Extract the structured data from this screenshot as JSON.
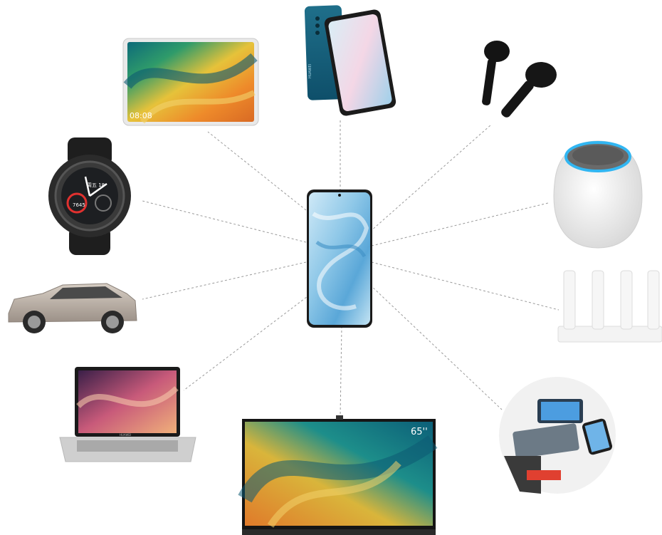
{
  "hub": {
    "icon": "smartphone-hub-icon"
  },
  "devices": [
    {
      "id": "tablet",
      "icon": "tablet-icon",
      "screen_time": "08:08"
    },
    {
      "id": "phone",
      "icon": "smartphone-icon",
      "brand": "HUAWEI"
    },
    {
      "id": "earbuds",
      "icon": "earbuds-icon"
    },
    {
      "id": "smartwatch",
      "icon": "smartwatch-icon",
      "dial_date": "周五 18",
      "dial_steps": "7645"
    },
    {
      "id": "smart-speaker",
      "icon": "speaker-icon"
    },
    {
      "id": "car",
      "icon": "car-icon"
    },
    {
      "id": "router",
      "icon": "router-icon"
    },
    {
      "id": "laptop",
      "icon": "laptop-icon",
      "brand": "HUAWEI"
    },
    {
      "id": "tv",
      "icon": "tv-icon",
      "size_label": "65''"
    },
    {
      "id": "treadmill",
      "icon": "treadmill-icon"
    }
  ],
  "colors": {
    "connector": "#9a9a9a",
    "screen_teal": "#0f6e6e",
    "screen_orange": "#e88a2a",
    "speaker_ring": "#31b6f2"
  }
}
